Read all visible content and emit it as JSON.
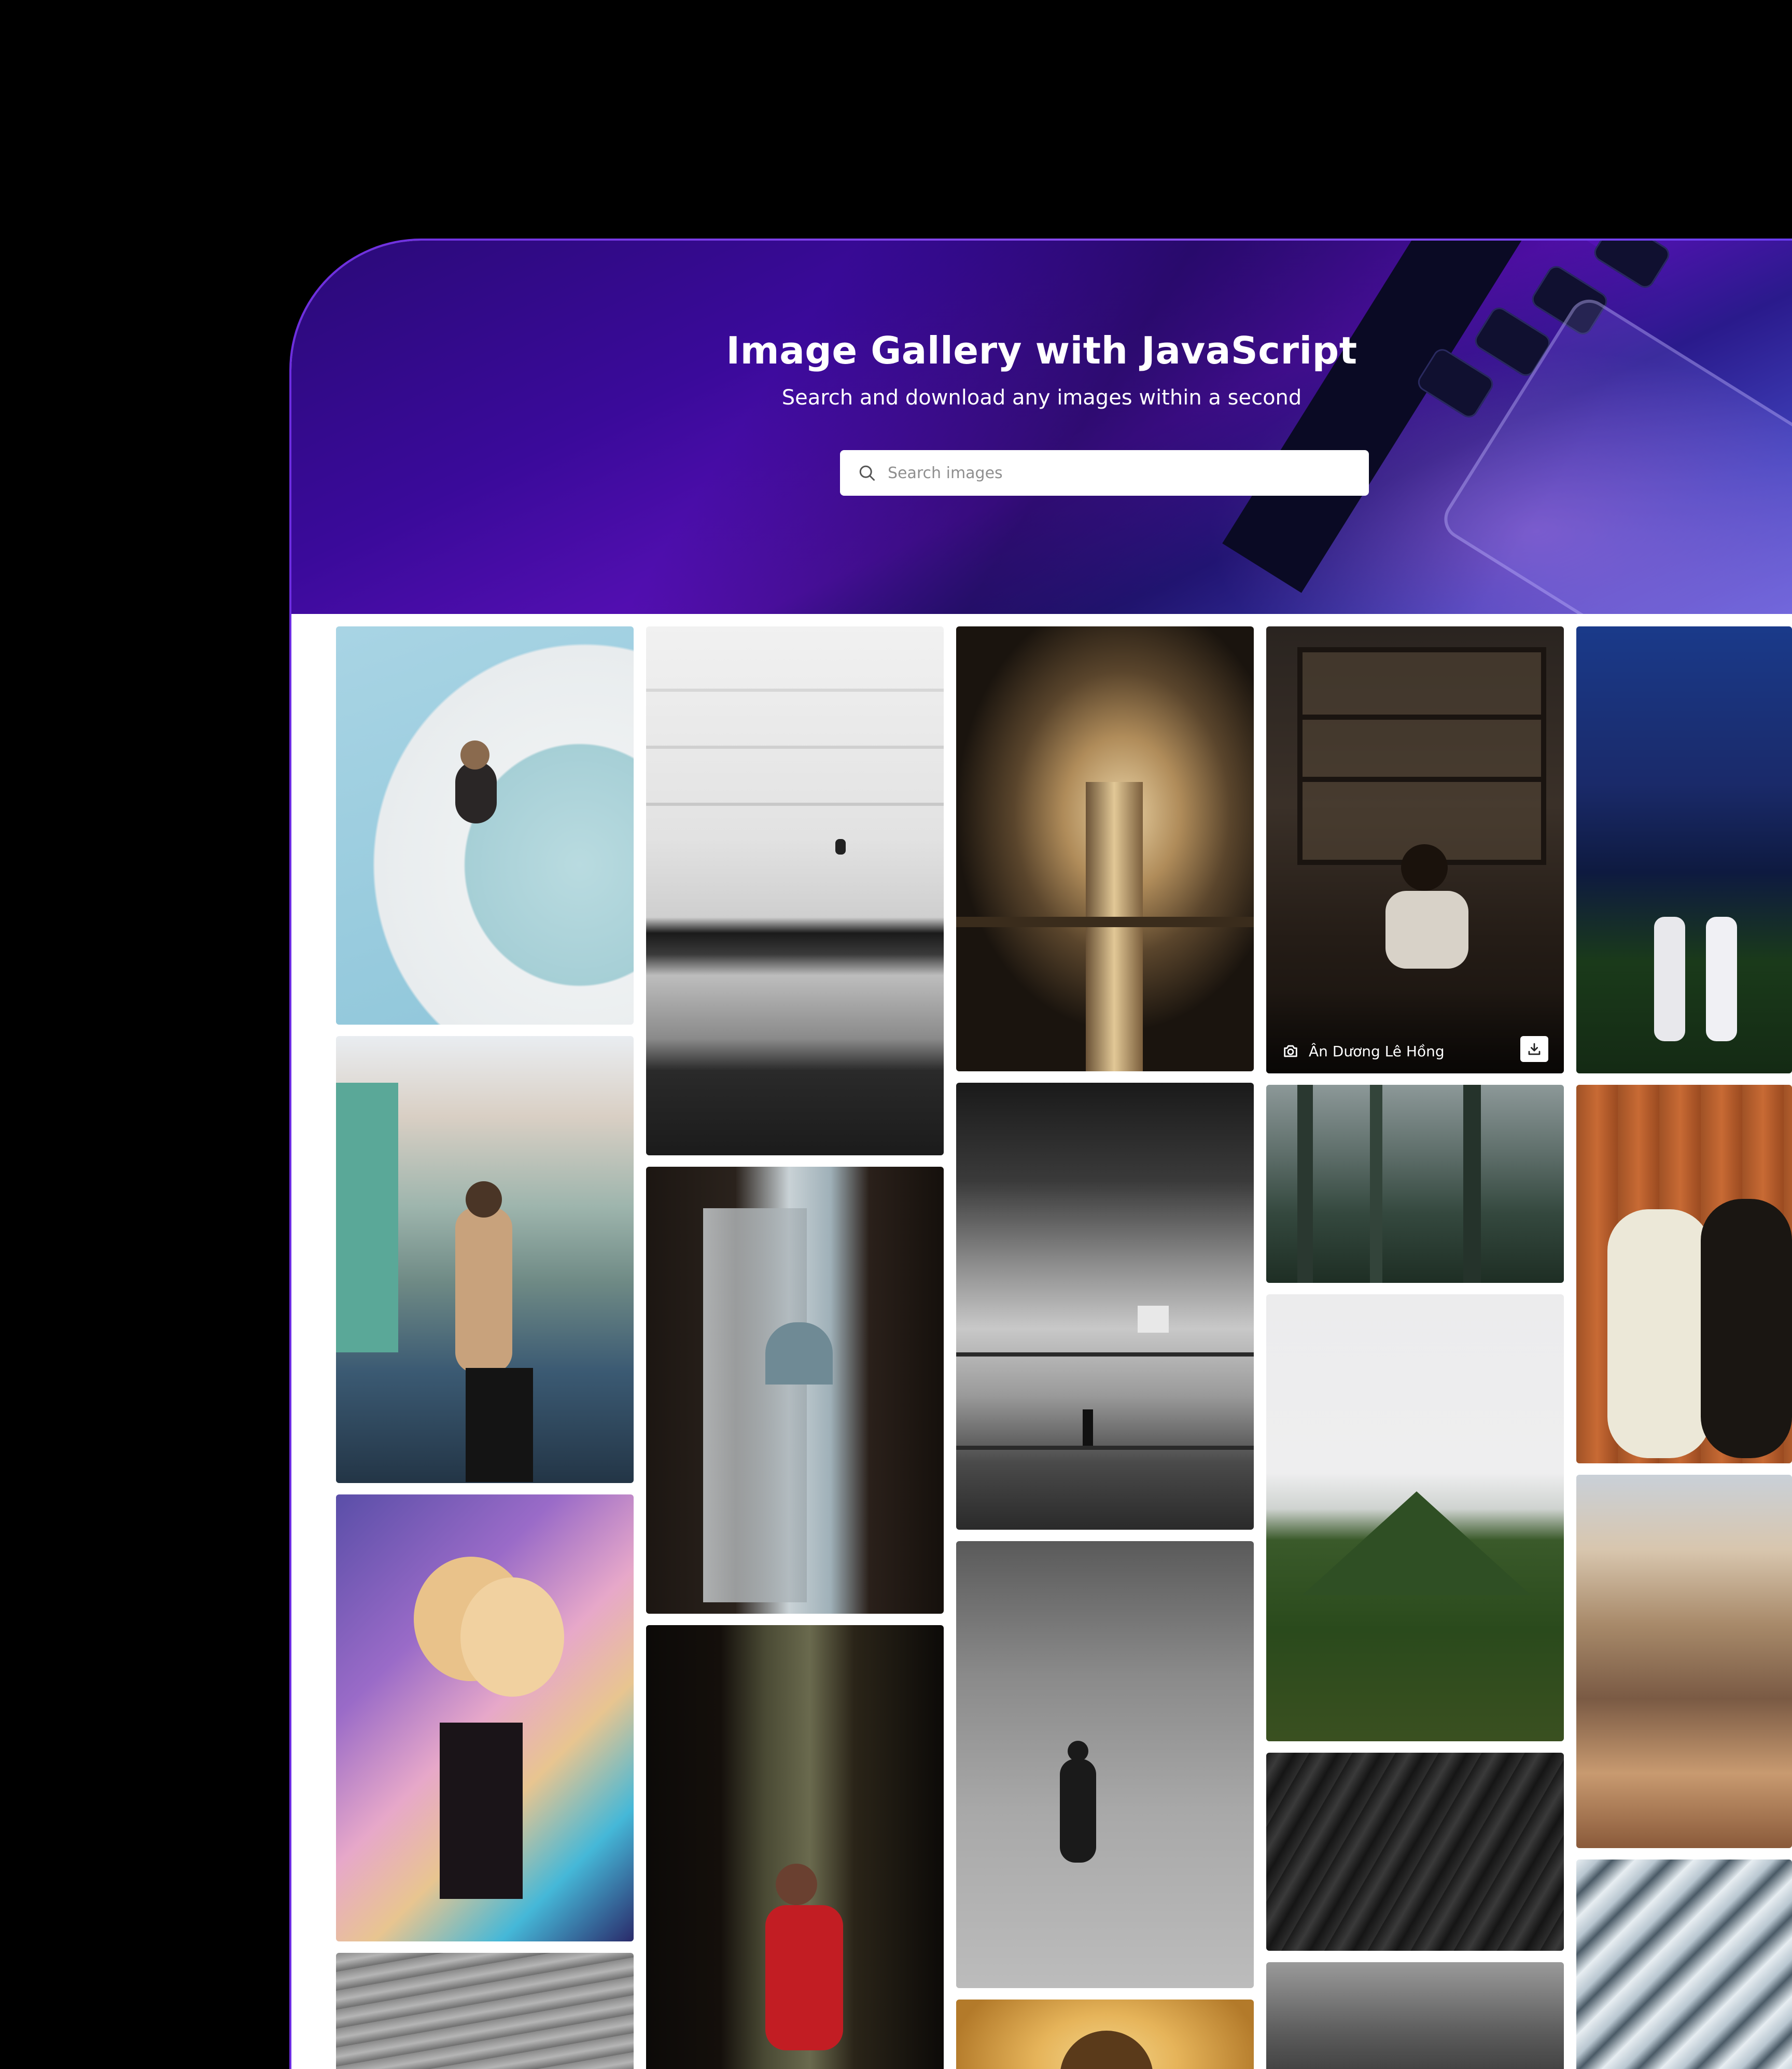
{
  "hero": {
    "title": "Image Gallery with JavaScript",
    "subtitle": "Search and download any images within a second"
  },
  "search": {
    "placeholder": "Search images",
    "icon": "search-icon"
  },
  "gallery": {
    "featured_credit": {
      "photographer": "Ân Dương Lê Hồng",
      "camera_icon": "camera-icon",
      "download_icon": "download-icon"
    },
    "tiles": [
      {
        "name": "pool-swimmer",
        "column": 1
      },
      {
        "name": "street-canal-portrait",
        "column": 1
      },
      {
        "name": "holographic-jacket-portrait",
        "column": 1
      },
      {
        "name": "sand-dunes",
        "column": 1
      },
      {
        "name": "white-architecture-stairs",
        "column": 2
      },
      {
        "name": "window-mosque-view",
        "column": 2
      },
      {
        "name": "doorway-woman",
        "column": 2
      },
      {
        "name": "ornate-column-hall",
        "column": 3
      },
      {
        "name": "spiral-building-bw",
        "column": 3
      },
      {
        "name": "desert-walker-bw",
        "column": 3
      },
      {
        "name": "golden-portrait",
        "column": 3
      },
      {
        "name": "woman-reading-shelves",
        "column": 4
      },
      {
        "name": "misty-forest",
        "column": 4
      },
      {
        "name": "foggy-mountain",
        "column": 4
      },
      {
        "name": "dark-rock-texture",
        "column": 4
      },
      {
        "name": "cloudy-peaks",
        "column": 4
      },
      {
        "name": "couple-night-palms",
        "column": 5
      },
      {
        "name": "couple-orange-curtain",
        "column": 5
      },
      {
        "name": "canyon-hiker",
        "column": 5
      },
      {
        "name": "snowy-ridge",
        "column": 5
      }
    ]
  }
}
